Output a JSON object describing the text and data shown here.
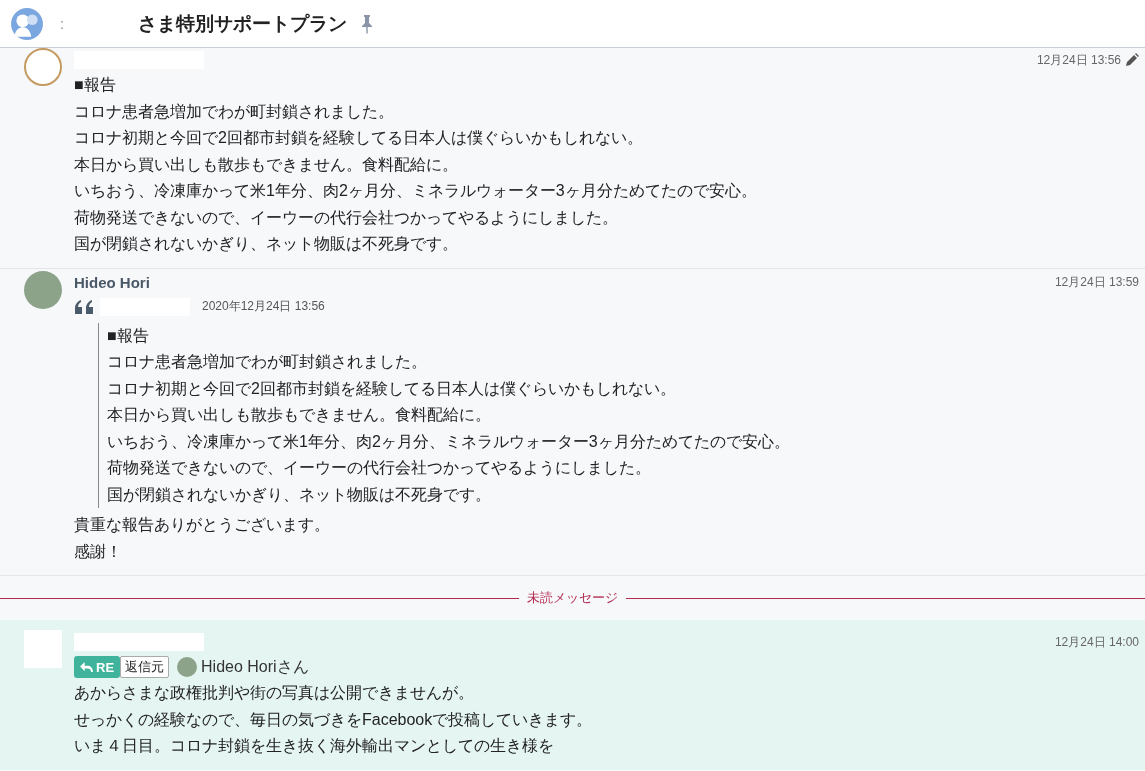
{
  "header": {
    "prefix": ":",
    "title": "さま特別サポートプラン"
  },
  "messages": [
    {
      "kind": "post",
      "time": "12月24日 13:56",
      "edited": true,
      "highlighted": false,
      "lines": [
        "■報告",
        "コロナ患者急増加でわが町封鎖されました。",
        "コロナ初期と今回で2回都市封鎖を経験してる日本人は僕ぐらいかもしれない。",
        "本日から買い出しも散歩もできません。食料配給に。",
        "いちおう、冷凍庫かって米1年分、肉2ヶ月分、ミネラルウォーター3ヶ月分ためてたので安心。",
        "荷物発送できないので、イーウーの代行会社つかってやるようにしました。",
        "国が閉鎖されないかぎり、ネット物販は不死身です。"
      ]
    },
    {
      "kind": "quote",
      "author": "Hideo Hori",
      "time": "12月24日 13:59",
      "edited": false,
      "highlighted": false,
      "quote": {
        "date": "2020年12月24日 13:56",
        "lines": [
          "■報告",
          "コロナ患者急増加でわが町封鎖されました。",
          "コロナ初期と今回で2回都市封鎖を経験してる日本人は僕ぐらいかもしれない。",
          "本日から買い出しも散歩もできません。食料配給に。",
          "いちおう、冷凍庫かって米1年分、肉2ヶ月分、ミネラルウォーター3ヶ月分ためてたので安心。",
          "荷物発送できないので、イーウーの代行会社つかってやるようにしました。",
          "国が閉鎖されないかぎり、ネット物販は不死身です。"
        ]
      },
      "lines": [
        "貴重な報告ありがとうございます。",
        "感謝！"
      ]
    },
    {
      "kind": "divider",
      "label": "未読メッセージ"
    },
    {
      "kind": "reply",
      "time": "12月24日 14:00",
      "edited": false,
      "highlighted": true,
      "reply_to": {
        "badge": "RE",
        "label": "返信元",
        "name": "Hideo Horiさん"
      },
      "lines": [
        "あからさまな政権批判や街の写真は公開できませんが。",
        "せっかくの経験なので、毎日の気づきをFacebookで投稿していきます。",
        "いま４日目。コロナ封鎖を生き抜く海外輸出マンとしての生き様を"
      ]
    }
  ]
}
